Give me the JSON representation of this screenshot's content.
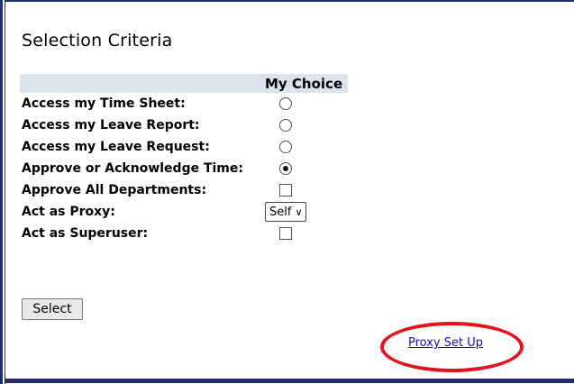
{
  "title": "Selection Criteria",
  "table": {
    "header_choice": "My Choice",
    "rows": [
      {
        "label": "Access my Time Sheet:",
        "control": "radio",
        "checked": false
      },
      {
        "label": "Access my Leave Report:",
        "control": "radio",
        "checked": false
      },
      {
        "label": "Access my Leave Request:",
        "control": "radio",
        "checked": false
      },
      {
        "label": "Approve or Acknowledge Time:",
        "control": "radio",
        "checked": true
      },
      {
        "label": "Approve All Departments:",
        "control": "checkbox",
        "checked": false
      },
      {
        "label": "Act as Proxy:",
        "control": "select",
        "value": "Self"
      },
      {
        "label": "Act as Superuser:",
        "control": "checkbox",
        "checked": false
      }
    ]
  },
  "buttons": {
    "select_label": "Select"
  },
  "links": {
    "proxy_setup": "Proxy Set Up"
  },
  "colors": {
    "border": "#1f2f6b",
    "header_bg": "#dde3ec",
    "highlight_oval": "#e0141b",
    "link": "#1a0dab"
  }
}
